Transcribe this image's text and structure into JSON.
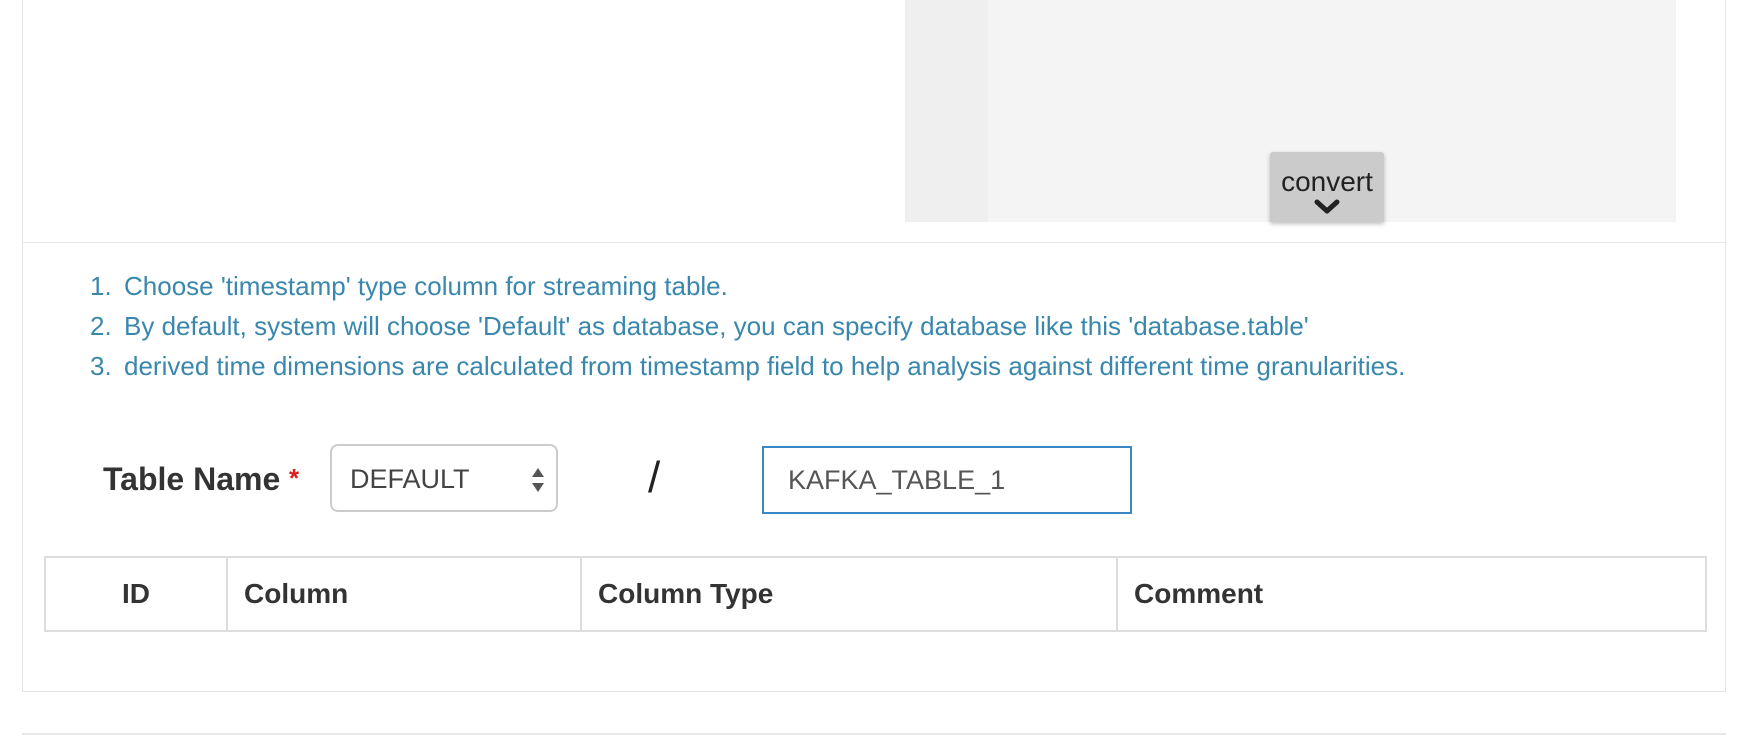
{
  "editor": {
    "convert_label": "convert"
  },
  "tips": [
    {
      "num": "1.",
      "text": "Choose 'timestamp' type column for streaming table."
    },
    {
      "num": "2.",
      "text": "By default, system will choose 'Default' as database, you can specify database like this 'database.table'"
    },
    {
      "num": "3.",
      "text": "derived time dimensions are calculated from timestamp field to help analysis against different time granularities."
    }
  ],
  "table_name": {
    "label": "Table Name",
    "required_mark": "*",
    "database_value": "DEFAULT",
    "separator": "/",
    "name_value": "KAFKA_TABLE_1"
  },
  "columns_table": {
    "headers": [
      "ID",
      "Column",
      "Column Type",
      "Comment"
    ]
  },
  "colors": {
    "tip_text": "#3a87ad",
    "required": "#d9201b",
    "input_focus_border": "#3a87c6"
  }
}
